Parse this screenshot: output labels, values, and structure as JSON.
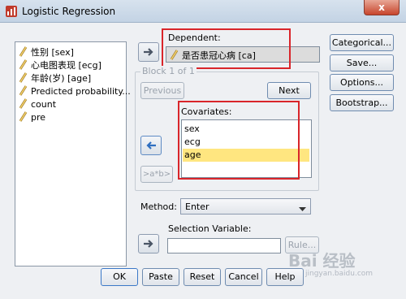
{
  "window": {
    "title": "Logistic Regression",
    "close_glyph": "x"
  },
  "variables": [
    {
      "label": "性别 [sex]",
      "icon": "ruler-icon"
    },
    {
      "label": "心电图表现 [ecg]",
      "icon": "ruler-icon"
    },
    {
      "label": "年龄(岁) [age]",
      "icon": "ruler-icon"
    },
    {
      "label": "Predicted probability...",
      "icon": "ruler-icon"
    },
    {
      "label": "count",
      "icon": "ruler-icon"
    },
    {
      "label": "pre",
      "icon": "ruler-icon"
    }
  ],
  "dependent": {
    "label": "Dependent:",
    "value": "是否患冠心病 [ca]"
  },
  "block": {
    "label": "Block 1 of 1",
    "previous": "Previous",
    "next": "Next"
  },
  "covariates": {
    "label": "Covariates:",
    "items": [
      "sex",
      "ecg",
      "age"
    ],
    "selected": "age"
  },
  "interaction_button": ">a*b>",
  "method": {
    "label": "Method:",
    "value": "Enter"
  },
  "selection": {
    "label": "Selection Variable:",
    "rule": "Rule..."
  },
  "side_buttons": [
    "Categorical...",
    "Save...",
    "Options...",
    "Bootstrap..."
  ],
  "bottom_buttons": [
    "OK",
    "Paste",
    "Reset",
    "Cancel",
    "Help"
  ],
  "watermark": "Bai 经验",
  "watermark_sub": "jingyan.baidu.com",
  "colors": {
    "highlight": "#ffe680",
    "annotation": "#d9252a"
  }
}
